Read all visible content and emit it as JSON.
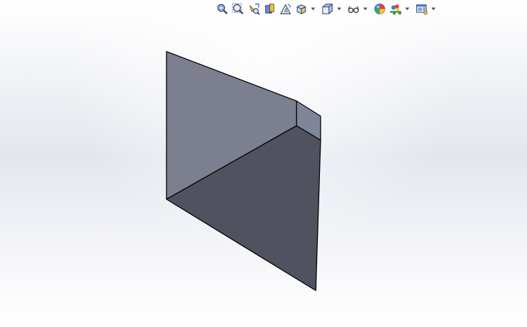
{
  "viewport": {
    "background_top": "#ffffff",
    "background_mid": "#e3e6ee"
  },
  "heads_up_toolbar": {
    "items": [
      {
        "icon": "zoom-to-fit-icon"
      },
      {
        "icon": "zoom-to-area-icon"
      },
      {
        "icon": "previous-view-icon"
      },
      {
        "icon": "section-view-icon"
      },
      {
        "icon": "dynamic-annotation-views-icon"
      },
      {
        "icon": "view-orientation-icon",
        "dropdown": true
      },
      {
        "icon": "display-style-icon",
        "dropdown": true
      },
      {
        "icon": "hide-show-items-icon",
        "dropdown": true
      },
      {
        "icon": "edit-appearance-icon"
      },
      {
        "icon": "apply-scene-icon",
        "dropdown": true
      },
      {
        "icon": "view-settings-icon",
        "dropdown": true
      }
    ]
  },
  "model": {
    "face_light_color": "#7b7f8f",
    "face_dark_color": "#50535f",
    "face_small_color": "#80869a",
    "edge_color": "#000000"
  }
}
